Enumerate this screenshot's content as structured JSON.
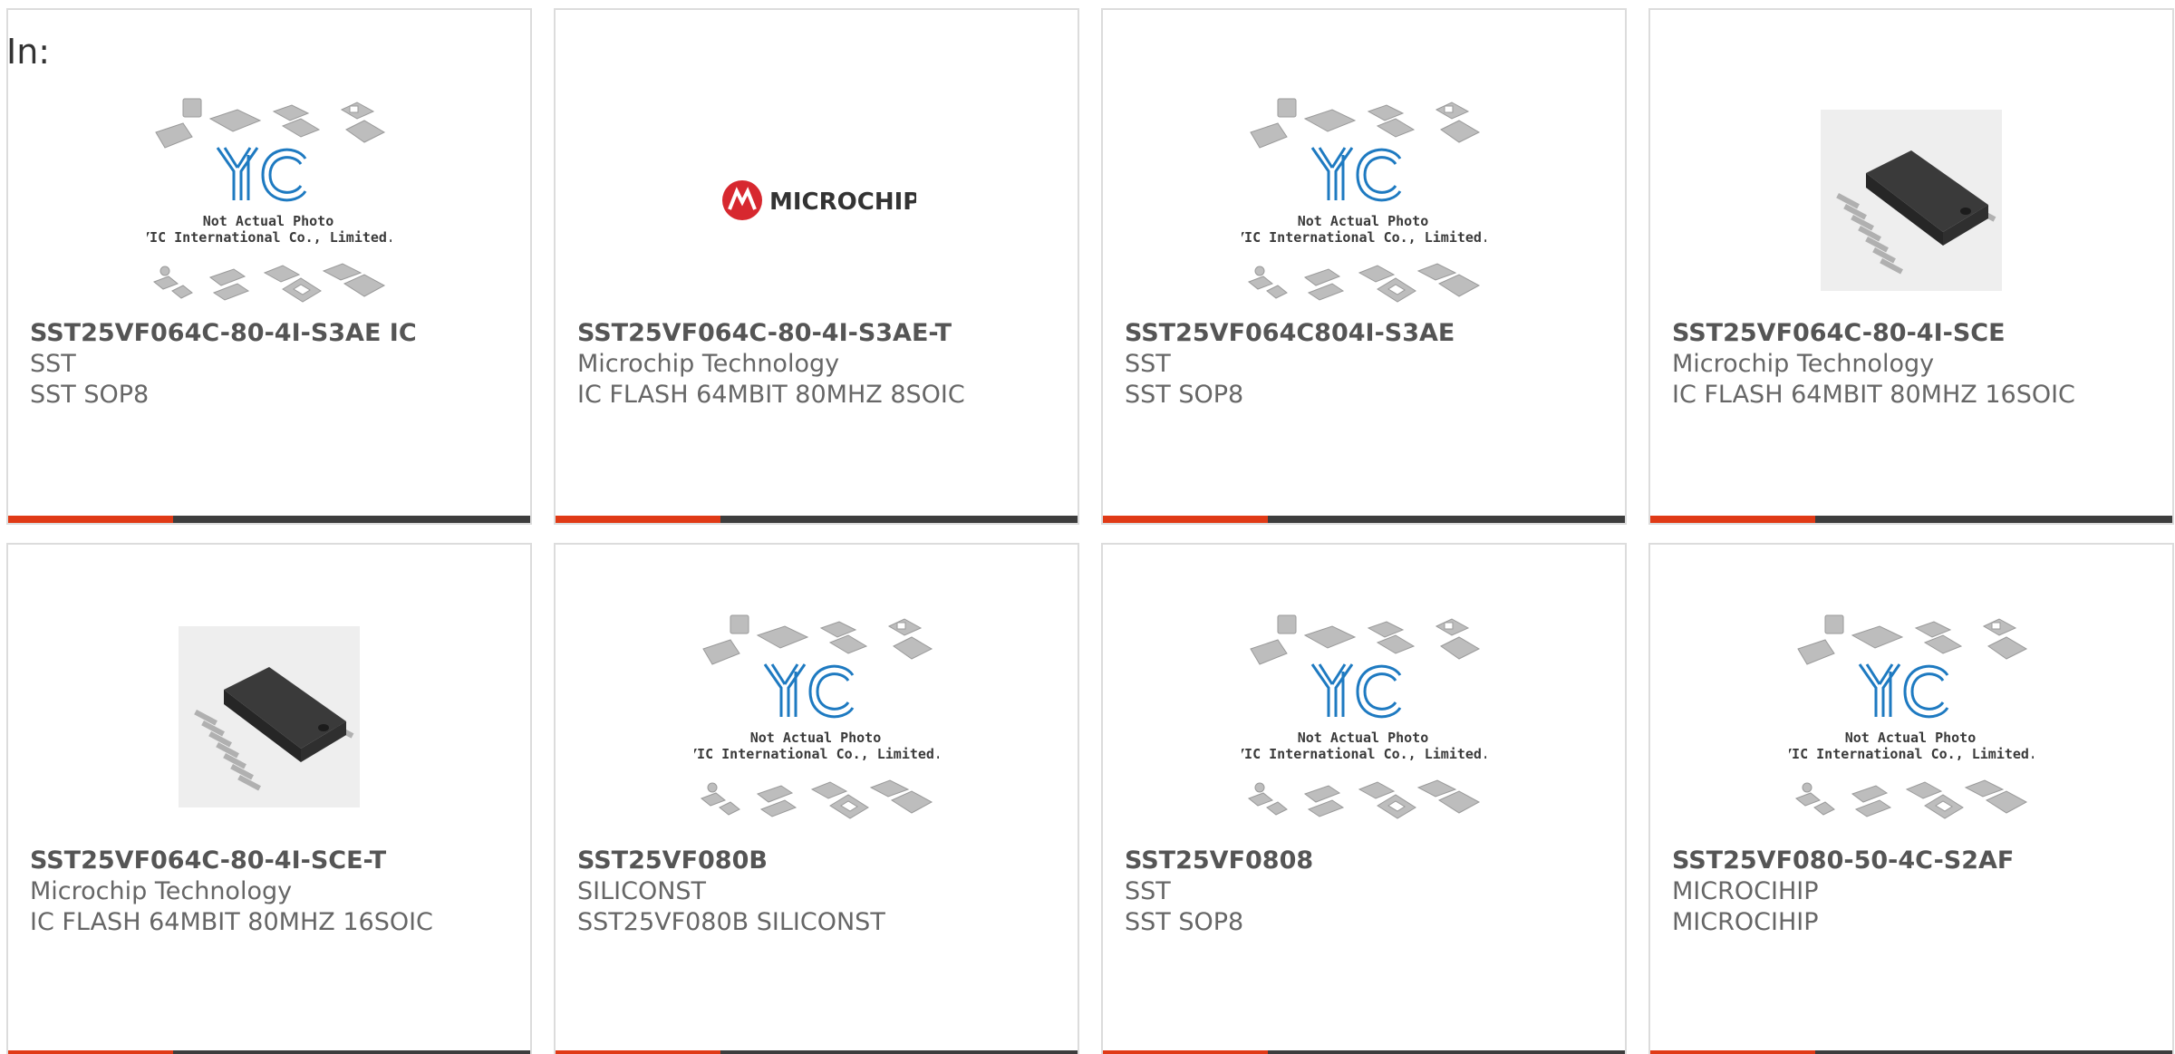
{
  "header": {
    "label": "In:"
  },
  "placeholder": {
    "line1": "Not Actual Photo",
    "line2": "YIC International Co., Limited.",
    "logo": "YIC"
  },
  "microchip_logo_text": "MICROCHIP",
  "colors": {
    "accent": "#e03a16",
    "bar_dark": "#3d3d3d",
    "logo_blue": "#1e7ac1",
    "microchip_red": "#d7282f"
  },
  "products": [
    {
      "part": "SST25VF064C-80-4I-S3AE IC",
      "manufacturer": "SST",
      "description": "SST SOP8",
      "image": "placeholder"
    },
    {
      "part": "SST25VF064C-80-4I-S3AE-T",
      "manufacturer": "Microchip Technology",
      "description": "IC FLASH 64MBIT 80MHZ 8SOIC",
      "image": "microchip-logo"
    },
    {
      "part": "SST25VF064C804I-S3AE",
      "manufacturer": "SST",
      "description": "SST SOP8",
      "image": "placeholder"
    },
    {
      "part": "SST25VF064C-80-4I-SCE",
      "manufacturer": "Microchip Technology",
      "description": "IC FLASH 64MBIT 80MHZ 16SOIC",
      "image": "chip-photo"
    },
    {
      "part": "SST25VF064C-80-4I-SCE-T",
      "manufacturer": "Microchip Technology",
      "description": "IC FLASH 64MBIT 80MHZ 16SOIC",
      "image": "chip-photo"
    },
    {
      "part": "SST25VF080B",
      "manufacturer": "SILICONST",
      "description": "SST25VF080B SILICONST",
      "image": "placeholder"
    },
    {
      "part": "SST25VF0808",
      "manufacturer": "SST",
      "description": "SST SOP8",
      "image": "placeholder"
    },
    {
      "part": "SST25VF080-50-4C-S2AF",
      "manufacturer": "MICROCIHIP",
      "description": "MICROCIHIP",
      "image": "placeholder"
    }
  ]
}
